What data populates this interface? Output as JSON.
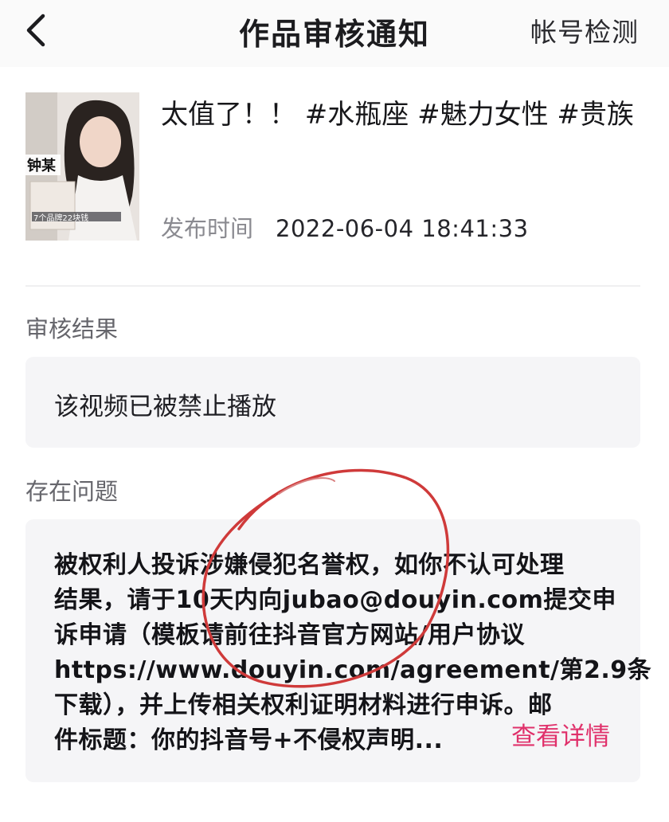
{
  "header": {
    "title": "作品审核通知",
    "right_action": "帐号检测"
  },
  "video": {
    "title": "太值了！！ #水瓶座 #魅力女性 #贵族",
    "publish_label": "发布时间",
    "publish_time": "2022-06-04 18:41:33",
    "thumbnail_caption": "钟某",
    "thumbnail_banner": "7个品牌22块钱"
  },
  "review": {
    "label": "审核结果",
    "result": "该视频已被禁止播放"
  },
  "issue": {
    "label": "存在问题",
    "lines": [
      "被权利人投诉涉嫌侵犯名誉权，如你不认可处理",
      "结果，请于10天内向jubao@douyin.com提交申",
      "诉申请（模板请前往抖音官方网站/用户协议",
      "https://www.douyin.com/agreement/第2.9条",
      "下载），并上传相关权利证明材料进行申诉。邮",
      "件标题：你的抖音号+不侵权声明..."
    ],
    "detail_link": "查看详情"
  },
  "colors": {
    "accent": "#e0316b",
    "annotation_circle": "#cf3a3a"
  },
  "icons": {
    "back": "chevron-left-icon"
  }
}
